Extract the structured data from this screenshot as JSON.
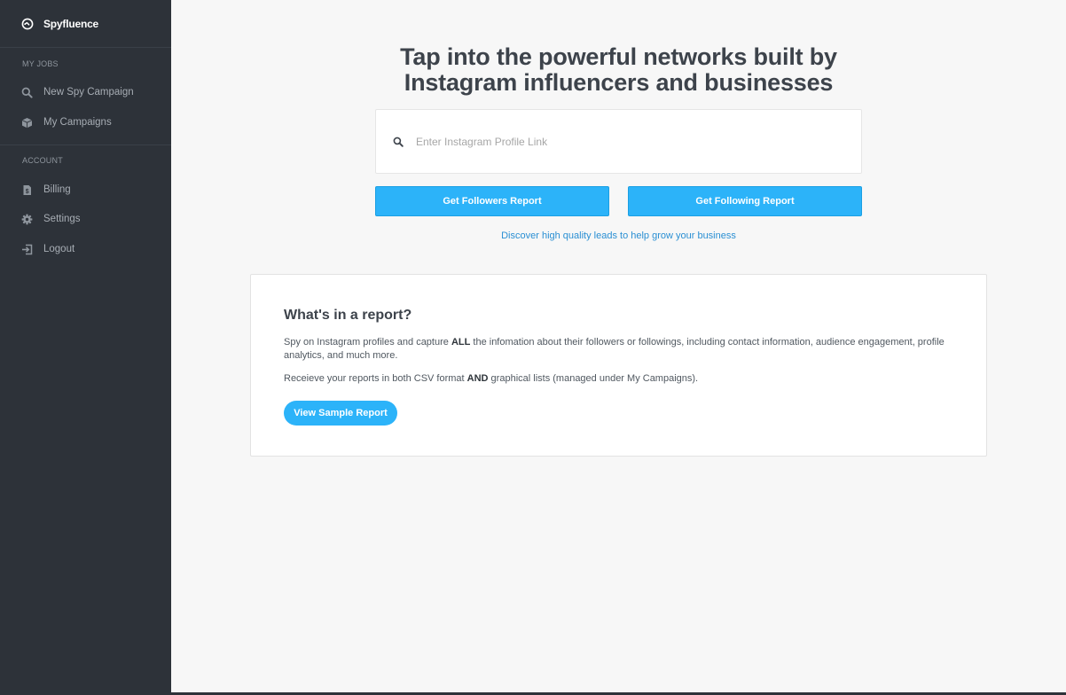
{
  "sidebar": {
    "brand": {
      "name": "Spyfluence",
      "icon": "spyfluence-logo-icon"
    },
    "sections": [
      {
        "label": "MY JOBS",
        "items": [
          {
            "label": "New Spy Campaign",
            "icon": "search-icon"
          },
          {
            "label": "My Campaigns",
            "icon": "cube-icon"
          }
        ]
      },
      {
        "label": "ACCOUNT",
        "items": [
          {
            "label": "Billing",
            "icon": "invoice-icon"
          },
          {
            "label": "Settings",
            "icon": "gear-icon"
          },
          {
            "label": "Logout",
            "icon": "logout-icon"
          }
        ]
      }
    ]
  },
  "main": {
    "hero_title_line1": "Tap into the powerful networks built by",
    "hero_title_line2": "Instagram influencers and businesses",
    "search": {
      "placeholder": "Enter Instagram Profile Link",
      "value": "",
      "icon": "search-icon"
    },
    "buttons": {
      "followers": "Get Followers Report",
      "following": "Get Following Report"
    },
    "discover_link": "Discover high quality leads to help grow your business",
    "report_card": {
      "title": "What's in a report?",
      "p1_before": "Spy on Instagram profiles and capture ",
      "p1_bold": "ALL",
      "p1_after": " the infomation about their followers or followings, including contact information, audience engagement, profile analytics, and much more.",
      "p2_before": "Receieve your reports in both CSV format ",
      "p2_bold": "AND",
      "p2_after": " graphical lists (managed under My Campaigns).",
      "sample_button": "View Sample Report"
    }
  },
  "colors": {
    "sidebar_bg": "#2d3239",
    "accent": "#2cb3f9",
    "link": "#2a8fd3",
    "page_bg": "#f7f7f7"
  }
}
